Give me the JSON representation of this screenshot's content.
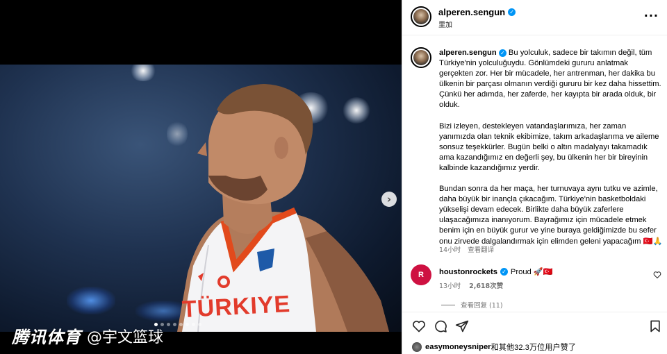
{
  "post": {
    "author": "alperen.sengun",
    "location": "里加",
    "caption_paragraphs": [
      "Bu yolculuk, sadece bir takımın değil, tüm Türkiye'nin yolculuğuydu. Gönlümdeki gururu anlatmak gerçekten zor. Her bir mücadele, her antrenman, her dakika bu ülkenin bir parçası olmanın verdiği gururu bir kez daha hissettim. Çünkü her adımda, her zaferde, her kayıpta bir arada olduk, bir olduk.",
      "Bizi izleyen, destekleyen vatandaşlarımıza, her zaman yanımızda olan teknik ekibimize, takım arkadaşlarıma ve aileme sonsuz teşekkürler. Bugün belki o altın madalyayı takamadık ama kazandığımız en değerli şey, bu ülkenin her bir bireyinin kalbinde kazandığımız yerdir.",
      "Bundan sonra da her maça, her turnuvaya aynı tutku ve azimle, daha büyük bir inançla çıkacağım. Türkiye'nin basketboldaki yükselişi devam edecek. Birlikte daha büyük zaferlere ulaşacağımıza inanıyorum. Bayrağımız için mücadele etmek benim için en büyük gurur ve yine buraya geldiğimizde bu sefer onu zirvede dalgalandırmak için elimden geleni yapacağım 🇹🇷🙏"
    ],
    "time": "14小时",
    "translate_label": "查看翻译",
    "likes_user": "easymoneysniper",
    "likes_text": "和其他32.3万位用户赞了"
  },
  "comment": {
    "user": "houstonrockets",
    "text": "Proud 🚀🇹🇷",
    "time": "13小时",
    "likes": "2,618次赞",
    "view_replies": "查看回复 (11)"
  },
  "media": {
    "watermark_brand": "腾讯体育",
    "watermark_handle": "@宇文篮球",
    "jersey_text": "TÜRKIYE",
    "slide_count": 8,
    "active_slide": 1
  },
  "icons": {
    "verified": "verified-badge-icon",
    "more": "more-options-icon",
    "next": "chevron-right-icon",
    "like": "heart-icon",
    "comment": "comment-icon",
    "share": "send-icon",
    "save": "bookmark-icon"
  },
  "colors": {
    "verified_blue": "#0095f6",
    "rockets_red": "#ce1141",
    "meta_gray": "#737373"
  }
}
